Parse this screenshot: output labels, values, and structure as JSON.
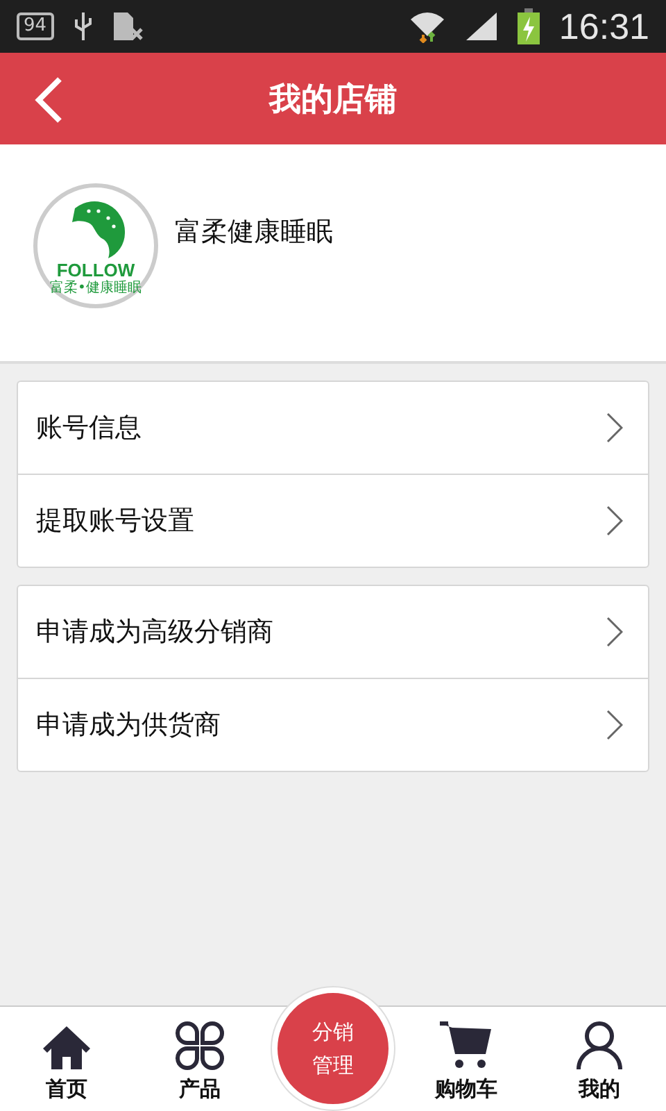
{
  "status_bar": {
    "notification_badge": "94",
    "time": "16:31"
  },
  "header": {
    "title": "我的店铺"
  },
  "store": {
    "name": "富柔健康睡眠",
    "logo_text": "FOLLOW",
    "logo_subtext": "富柔•健康睡眠"
  },
  "menu_groups": [
    {
      "items": [
        {
          "label": "账号信息"
        },
        {
          "label": "提取账号设置"
        }
      ]
    },
    {
      "items": [
        {
          "label": "申请成为高级分销商"
        },
        {
          "label": "申请成为供货商"
        }
      ]
    }
  ],
  "bottom_nav": {
    "items": [
      {
        "label": "首页",
        "kind": "home"
      },
      {
        "label": "产品",
        "kind": "grid"
      },
      {
        "label": "分销管理",
        "kind": "center"
      },
      {
        "label": "购物车",
        "kind": "cart"
      },
      {
        "label": "我的",
        "kind": "user"
      }
    ]
  }
}
